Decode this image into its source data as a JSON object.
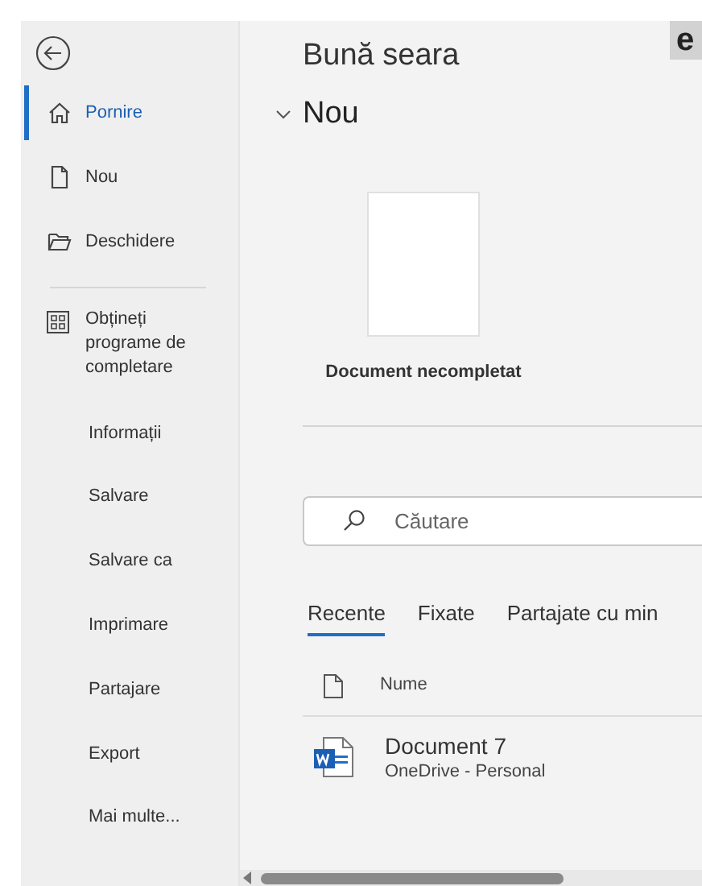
{
  "sidebar": {
    "top_items": [
      {
        "label": "Pornire",
        "selected": true
      },
      {
        "label": "Nou",
        "selected": false
      },
      {
        "label": "Deschidere",
        "selected": false
      }
    ],
    "addin_item": {
      "label": "Obțineți programe de completare",
      "selected": false
    },
    "items": [
      {
        "label": "Informații",
        "selected": false
      },
      {
        "label": "Salvare",
        "selected": false
      },
      {
        "label": "Salvare ca",
        "selected": false
      },
      {
        "label": "Imprimare",
        "selected": false
      },
      {
        "label": "Partajare",
        "selected": false
      },
      {
        "label": "Export",
        "selected": false
      },
      {
        "label": "Mai multe...",
        "selected": false
      }
    ]
  },
  "main": {
    "greeting": "Bună seara",
    "corner_badge": "e",
    "section": {
      "title": "Nou",
      "expanded": true
    },
    "templates": [
      {
        "label": "Document necompletat"
      }
    ],
    "search": {
      "placeholder": "Căutare"
    },
    "tabs": [
      {
        "label": "Recente",
        "selected": true
      },
      {
        "label": "Fixate",
        "selected": false
      },
      {
        "label": "Partajate cu min",
        "selected": false
      }
    ],
    "file_list": {
      "columns": [
        "Nume"
      ],
      "rows": [
        {
          "name": "Document 7",
          "location": "OneDrive - Personal"
        }
      ]
    }
  }
}
